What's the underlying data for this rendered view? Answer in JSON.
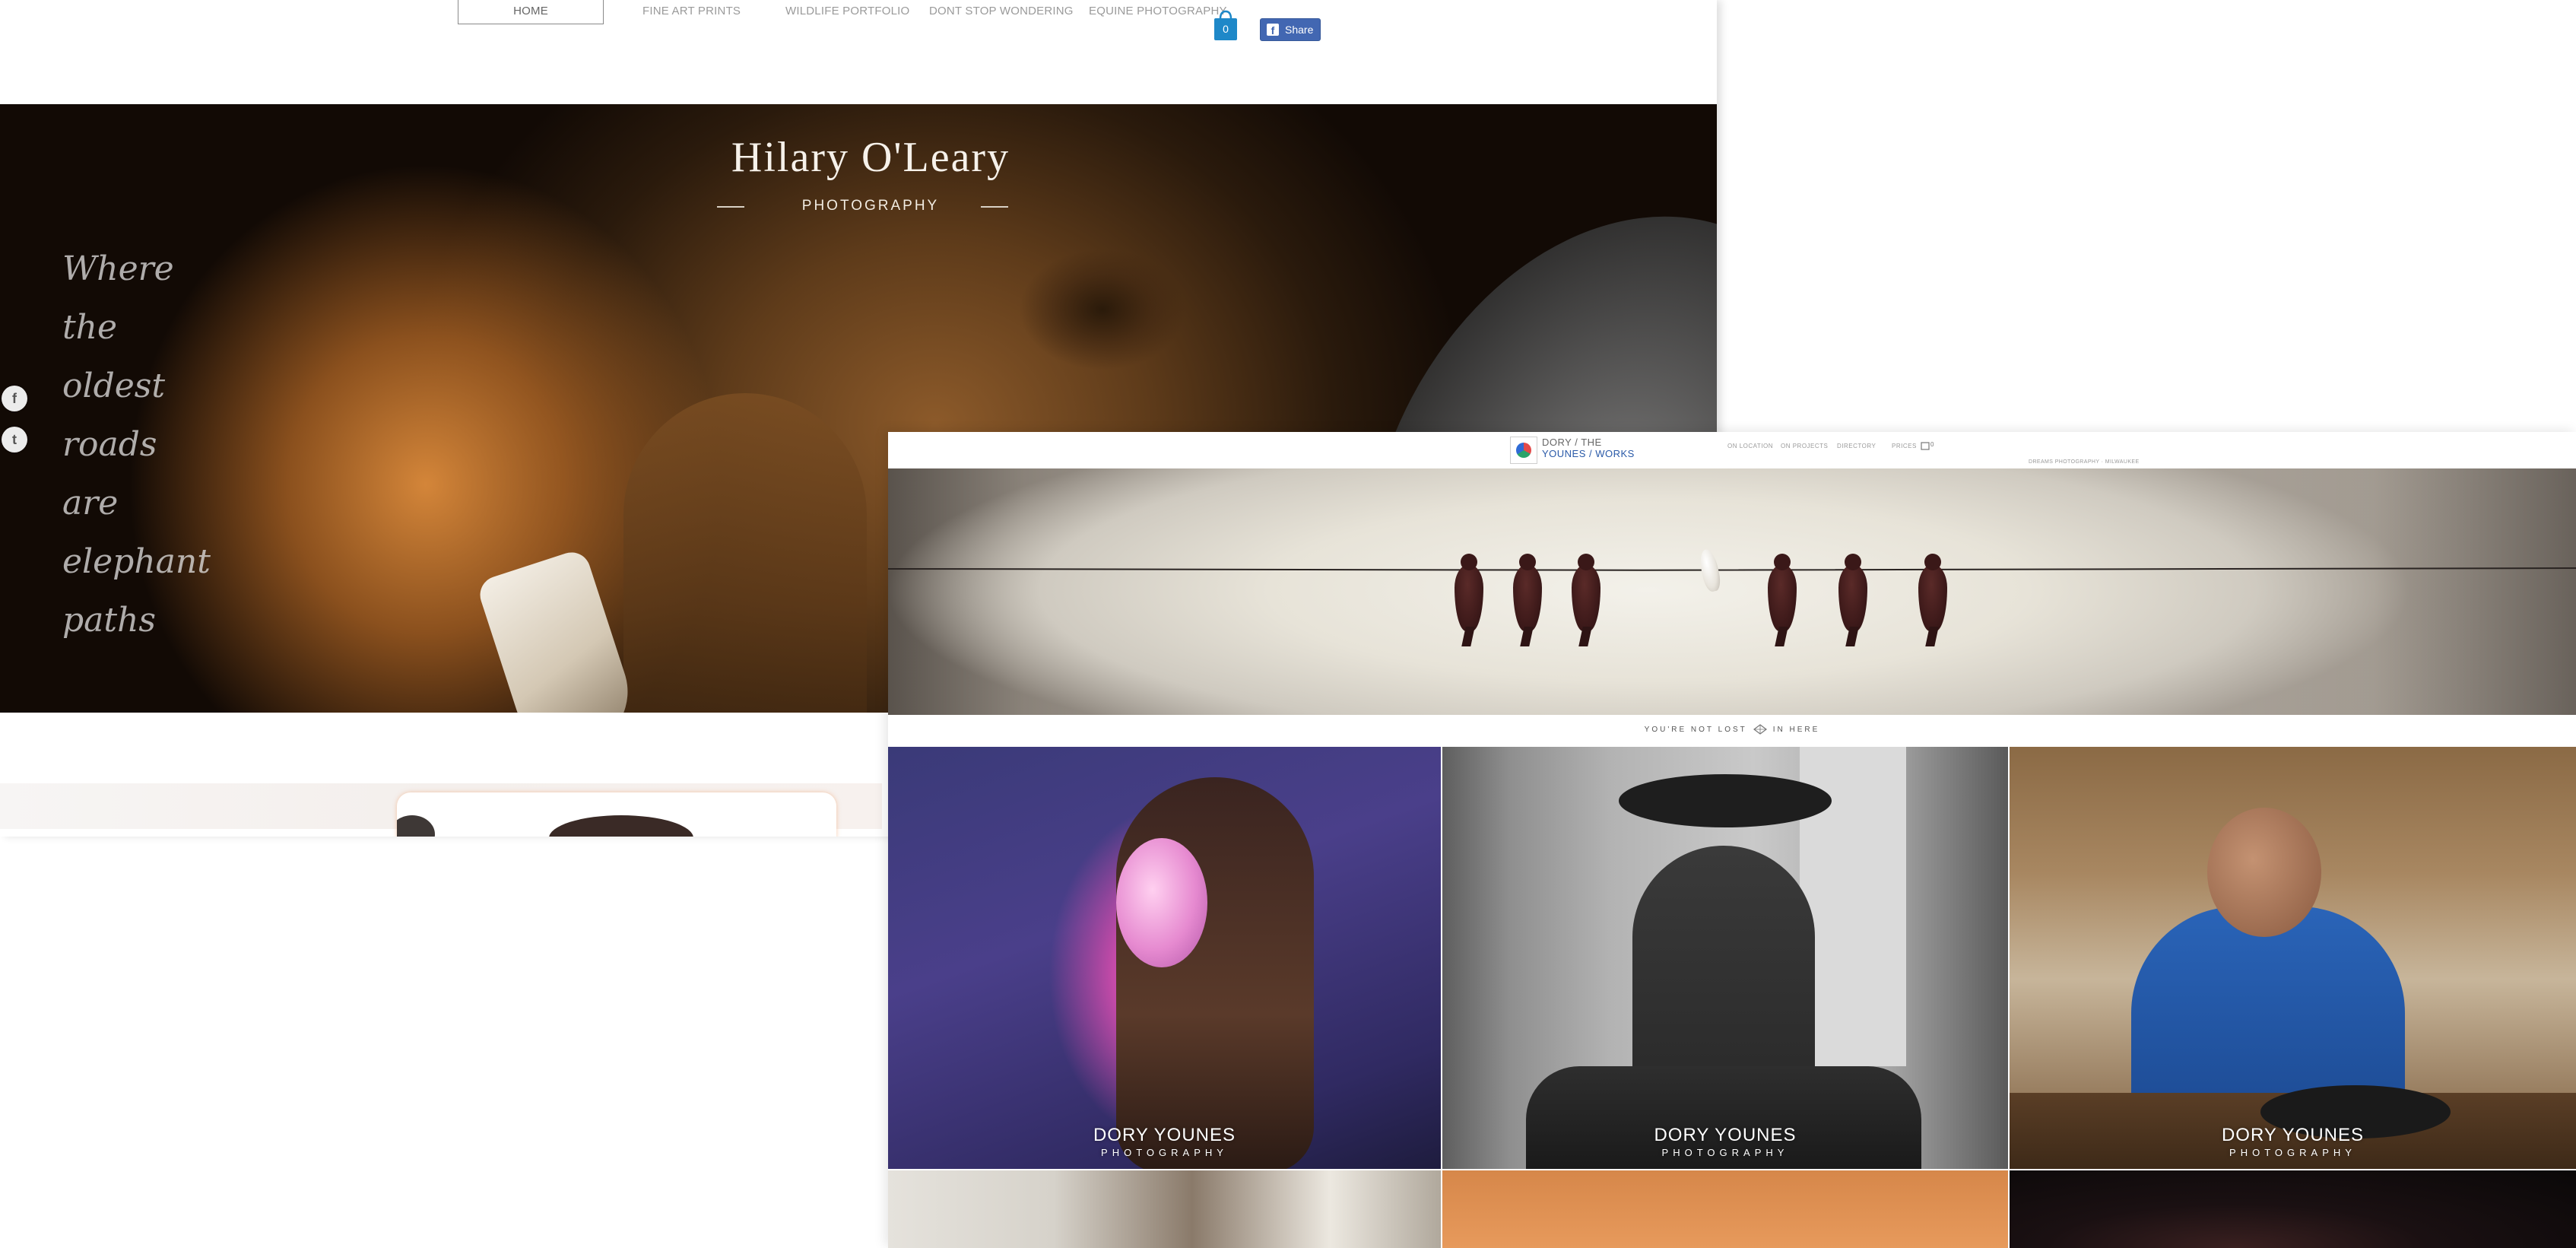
{
  "site1": {
    "nav": {
      "items": [
        "HOME",
        "FINE ART PRINTS",
        "WILDLIFE PORTFOLIO",
        "DONT STOP WONDERING",
        "EQUINE PHOTOGRAPHY"
      ]
    },
    "cart": {
      "count": "0"
    },
    "share_label": "Share",
    "hero": {
      "title": "Hilary O'Leary",
      "subtitle": "PHOTOGRAPHY",
      "quote_lines": [
        "Where",
        "the",
        "oldest",
        "roads",
        "are",
        "elephant",
        "paths"
      ]
    },
    "social": {
      "facebook_glyph": "f",
      "twitter_glyph": "t"
    }
  },
  "site2": {
    "logo": {
      "line1": "DORY / THE",
      "line2": "YOUNES / WORKS"
    },
    "nav": {
      "items": [
        "ON LOCATION",
        "ON PROJECTS",
        "DIRECTORY",
        "PRICES"
      ]
    },
    "cart_count": "0",
    "tagline": "DREAMS PHOTOGRAPHY · MILWAUKEE",
    "lost_left": "YOU'RE NOT LOST",
    "lost_right": "IN HERE",
    "tiles": [
      {
        "name": "DORY YOUNES",
        "sub": "PHOTOGRAPHY"
      },
      {
        "name": "DORY YOUNES",
        "sub": "PHOTOGRAPHY"
      },
      {
        "name": "DORY YOUNES",
        "sub": "PHOTOGRAPHY"
      }
    ]
  },
  "colors": {
    "facebook_blue": "#4267b2",
    "cart_blue": "#1e88c8",
    "logo_blue": "#2a5aa8"
  },
  "icons": [
    "shopping-bag-icon",
    "facebook-icon",
    "twitter-icon",
    "diamond-icon",
    "cart-icon"
  ]
}
